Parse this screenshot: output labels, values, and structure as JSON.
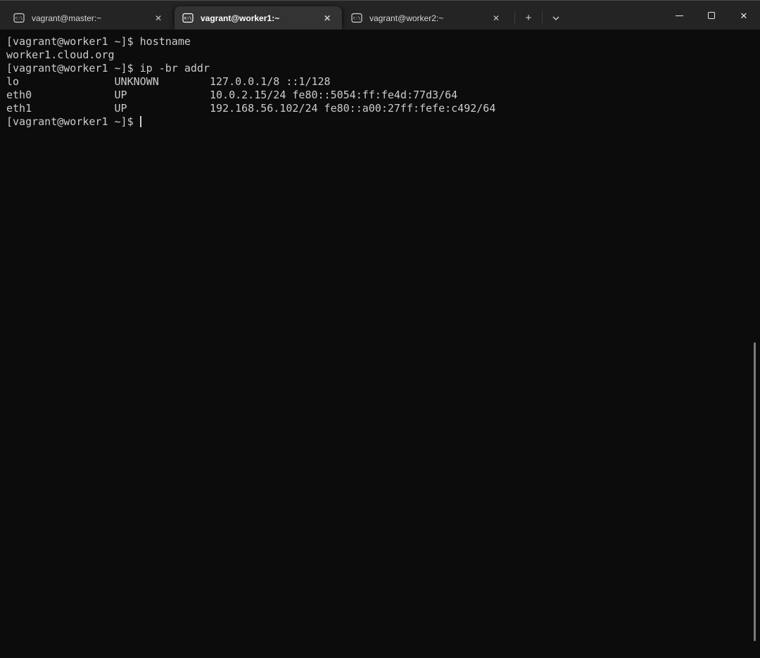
{
  "colors": {
    "terminal_background": "#0c0c0c",
    "terminal_foreground": "#cccccc",
    "titlebar_background": "#242424",
    "active_tab_background": "#333333"
  },
  "icons": {
    "terminal_glyph": "c:\\",
    "close": "✕",
    "new_tab": "+",
    "minimize": "minimize-line",
    "maximize": "maximize-square",
    "chevron_down": "⌄"
  },
  "tabbar": {
    "tabs": [
      {
        "label": "vagrant@master:~",
        "active": false
      },
      {
        "label": "vagrant@worker1:~",
        "active": true
      },
      {
        "label": "vagrant@worker2:~",
        "active": false
      }
    ]
  },
  "terminal": {
    "lines": [
      "[vagrant@worker1 ~]$ hostname",
      "worker1.cloud.org",
      "[vagrant@worker1 ~]$ ip -br addr",
      "lo               UNKNOWN        127.0.0.1/8 ::1/128",
      "eth0             UP             10.0.2.15/24 fe80::5054:ff:fe4d:77d3/64",
      "eth1             UP             192.168.56.102/24 fe80::a00:27ff:fefe:c492/64",
      "[vagrant@worker1 ~]$ "
    ]
  }
}
